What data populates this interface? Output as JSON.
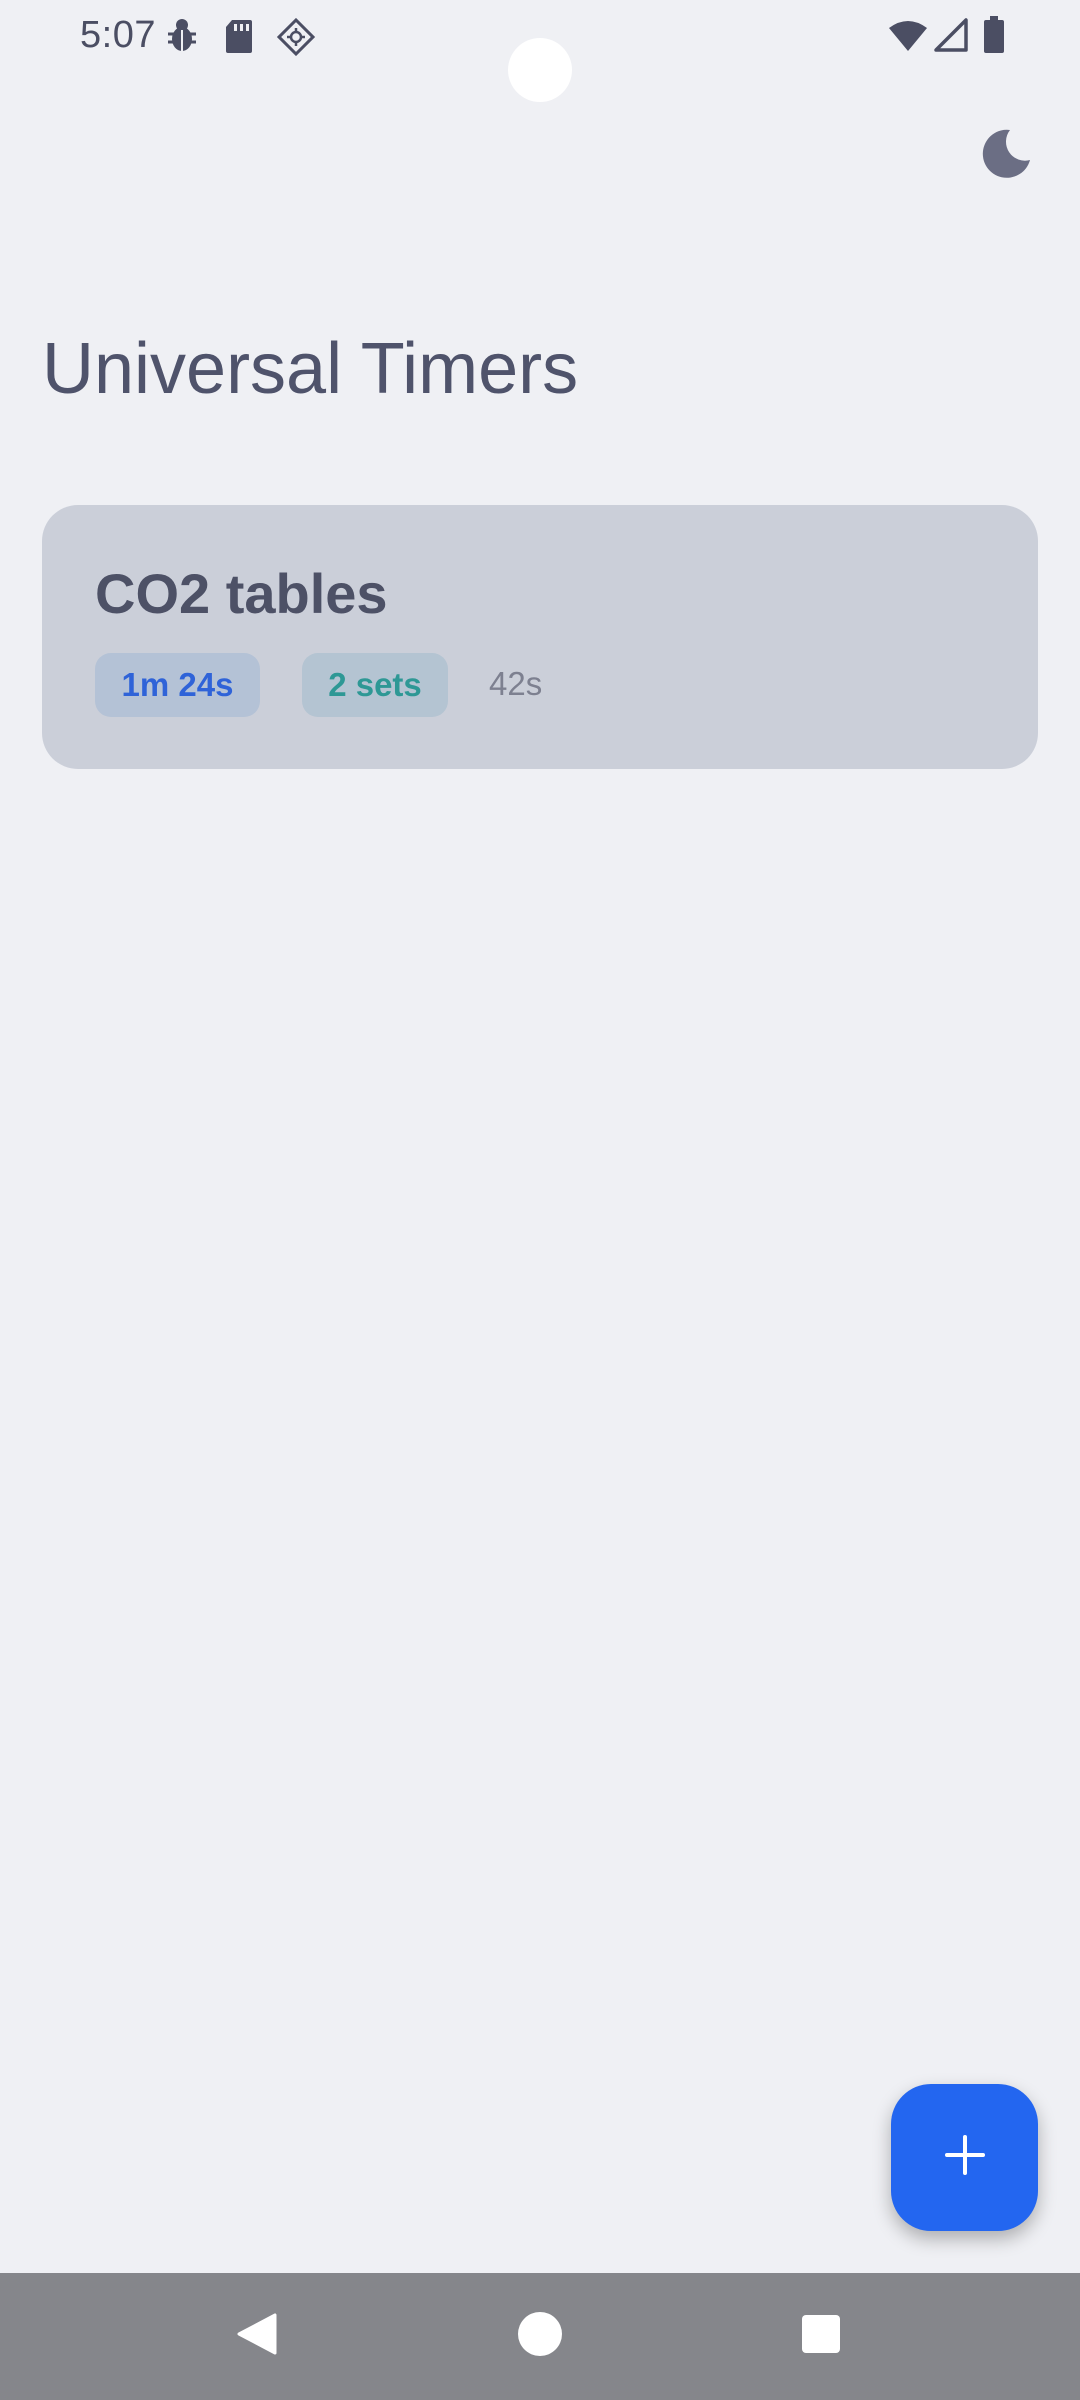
{
  "status_bar": {
    "time": "5:07",
    "left_icons": [
      "bug-icon",
      "sd-card-icon",
      "location-diamond-icon"
    ],
    "right_icons": [
      "wifi-icon",
      "signal-icon",
      "battery-icon"
    ]
  },
  "header": {
    "theme_toggle_icon": "moon-icon"
  },
  "main": {
    "title": "Universal Timers",
    "timers": [
      {
        "name": "CO2 tables",
        "total_duration": "1m 24s",
        "sets": "2 sets",
        "rest": "42s"
      }
    ]
  },
  "fab": {
    "icon": "plus-icon"
  },
  "nav_bar": {
    "buttons": [
      "back-icon",
      "home-icon",
      "recents-icon"
    ]
  },
  "colors": {
    "background": "#eff0f4",
    "card": "#cbcfd9",
    "accent": "#2366f0",
    "duration_chip_text": "#2f63d8",
    "sets_chip_text": "#2e9895",
    "title_text": "#4f536b",
    "nav_bar": "#85868b"
  }
}
